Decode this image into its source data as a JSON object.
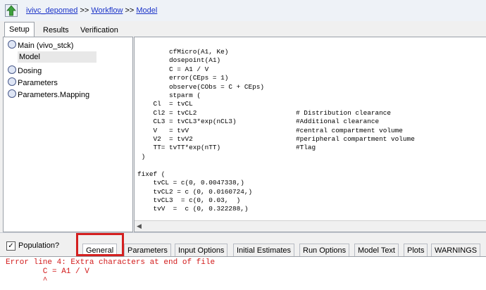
{
  "breadcrumb": {
    "items": [
      "ivivc_depomed",
      "Workflow",
      "Model"
    ],
    "separator": ">>"
  },
  "tabs": [
    "Setup",
    "Results",
    "Verification"
  ],
  "tree": {
    "items": [
      "Main (vivo_stck)",
      "Model",
      "Dosing",
      "Parameters",
      "Parameters.Mapping"
    ],
    "selected": "Model"
  },
  "code_lines": [
    "        cfMicro(A1, Ke)",
    "        dosepoint(A1)",
    "        C = A1 / V",
    "        error(CEps = 1)",
    "        observe(CObs = C + CEps)",
    "        stparm (",
    "    Cl  = tvCL",
    "    Cl2 = tvCL2                         # Distribution clearance",
    "    CL3 = tvCL3*exp(nCL3)               #Additional clearance",
    "    V   = tvV                           #central compartment volume",
    "    V2  = tvV2                          #peripheral compartment volume",
    "    TT= tvTT*exp(nTT)                   #Tlag",
    " )",
    "",
    "fixef (",
    "    tvCL = c(0, 0.0047338,)",
    "    tvCL2 = c (0, 0.0160724,)",
    "    tvCL3  = c(0, 0.03,  )",
    "    tvV  =  c (0, 0.322288,)"
  ],
  "population": {
    "label": "Population?",
    "checked": true
  },
  "bottom_tabs": [
    "General",
    "Parameters",
    "Input Options",
    "Initial Estimates",
    "Run Options",
    "Model Text",
    "Plots",
    "WARNINGS"
  ],
  "bottom_active": "General",
  "error_lines": [
    "Error line 4: Extra characters at end of file",
    "        C = A1 / V",
    "        ^"
  ],
  "colors": {
    "link": "#1a33c8",
    "error": "#d21a1a",
    "highlight": "#d42020"
  },
  "icons": {
    "home": "green-up-arrow-icon",
    "tree": "node-icon",
    "check": "checkmark-icon"
  }
}
